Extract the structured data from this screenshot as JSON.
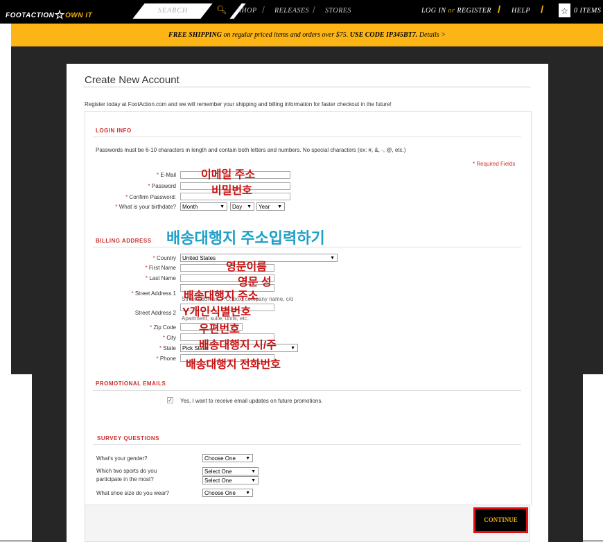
{
  "nav": {
    "logo_prefix": "FOOTACTION",
    "logo_suffix": "OWN IT",
    "search_placeholder": "SEARCH",
    "links": [
      "SHOP",
      "RELEASES",
      "STORES"
    ],
    "login": "LOG IN",
    "or": "or",
    "register": "REGISTER",
    "help": "HELP",
    "cart": "0 ITEMS"
  },
  "promo": {
    "bold1": "FREE SHIPPING",
    "text1": " on regular priced items and orders over $75. ",
    "bold2": "USE CODE IP345BT7.",
    "link": " Details >"
  },
  "page": {
    "title": "Create New Account",
    "intro": "Register today at FootAction.com and we will remember your shipping and billing information for faster checkout in the future!"
  },
  "login_info": {
    "heading": "LOGIN INFO",
    "note": "Passwords must be 6-10 characters in length and contain both letters and numbers. No special characters (ex: #, &, -, @, etc.)",
    "required": "* Required Fields",
    "email_label": "E-Mail",
    "password_label": "Password",
    "confirm_label": "Confirm Password:",
    "birthdate_label": "What is your birthdate?",
    "month": "Month",
    "day": "Day",
    "year": "Year"
  },
  "billing": {
    "heading": "BILLING ADDRESS",
    "country_label": "Country",
    "country_value": "United States",
    "first_label": "First Name",
    "last_label": "Last Name",
    "street1_label": "Street Address 1",
    "street1_hint": "Street Address, P.O. box, company name, c/o",
    "street2_label": "Street Address 2",
    "street2_hint": "Apartment, suite, units, etc.",
    "zip_label": "Zip Code",
    "city_label": "City",
    "state_label": "State",
    "state_value": "Pick State",
    "phone_label": "Phone"
  },
  "annotations": {
    "email": "이메일 주소",
    "password": "비밀번호",
    "billing": "배송대행지 주소입력하기",
    "first": "영문이름",
    "last": "영문 성",
    "street1": "배송대행지 주소",
    "street2": "Y개인식별번호",
    "zip": "우편번호",
    "city": "배송대행지 시/주",
    "phone": "배송대행지 전화번호"
  },
  "promotional": {
    "heading": "PROMOTIONAL EMAILS",
    "checkbox_label": "Yes, I want to receive email updates on future promotions.",
    "checked": true
  },
  "survey": {
    "heading": "SURVEY QUESTIONS",
    "gender_q": "What's your gender?",
    "gender_value": "Choose One",
    "sports_q1": "Which two sports do you",
    "sports_q2": "participate in the most?",
    "sports_value1": "Select One",
    "sports_value2": "Select One",
    "shoe_q": "What shoe size do you wear?",
    "shoe_value": "Choose One"
  },
  "continue_label": "CONTINUE"
}
